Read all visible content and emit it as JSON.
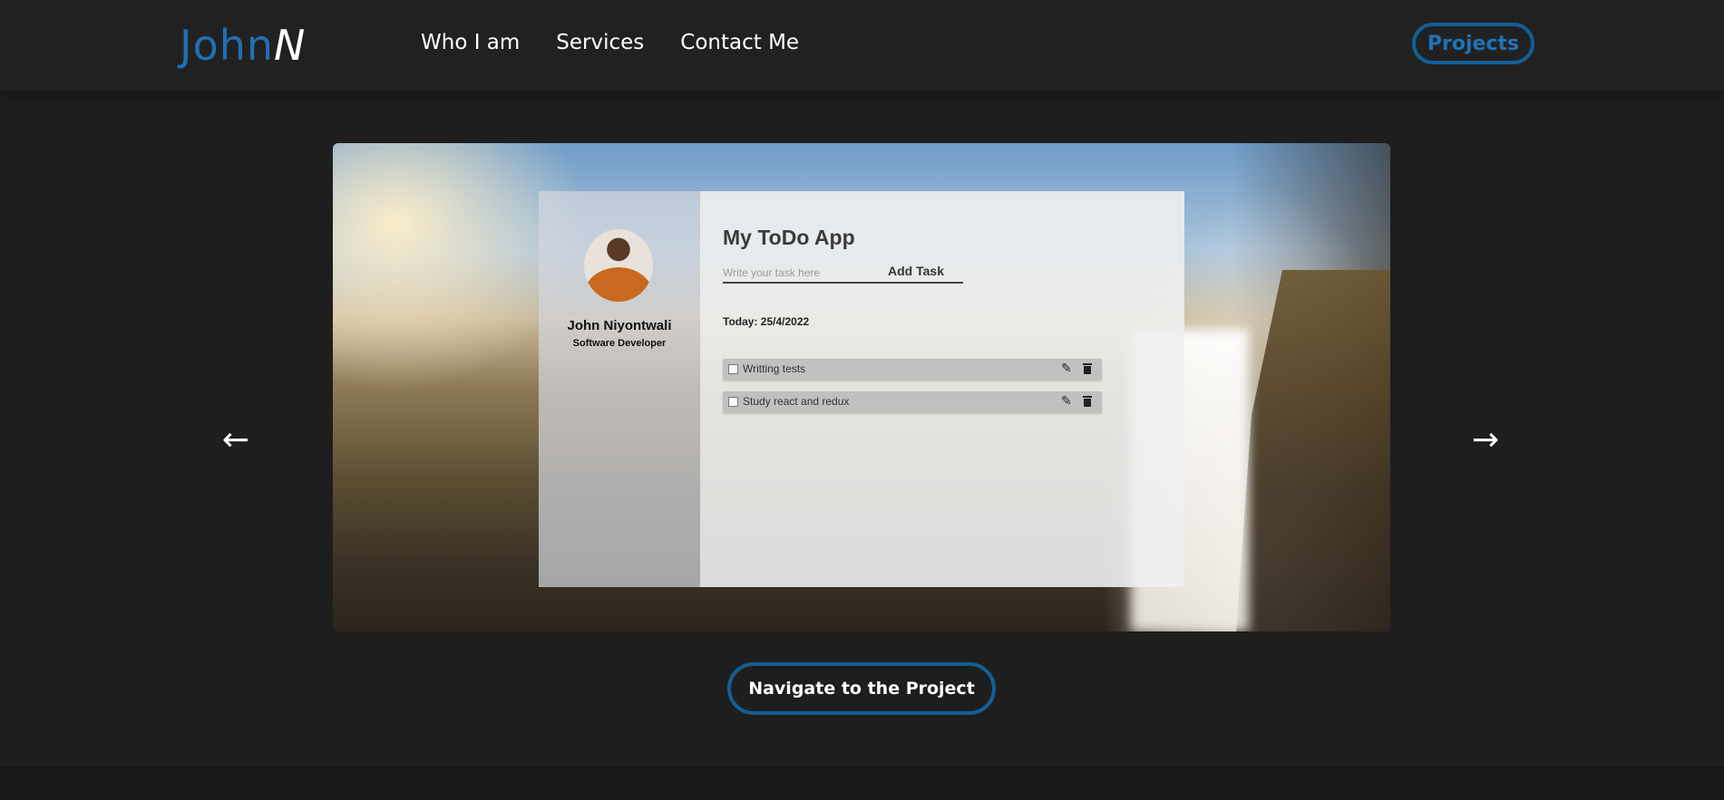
{
  "header": {
    "logo_part1": "John",
    "logo_part2": "N",
    "nav": [
      "Who I am",
      "Services",
      "Contact Me"
    ],
    "projects_label": "Projects"
  },
  "carousel": {
    "prev_arrow": "←",
    "next_arrow": "→"
  },
  "todo": {
    "profile_name": "John Niyontwali",
    "profile_role": "Software Developer",
    "title": "My ToDo App",
    "input_placeholder": "Write your task here",
    "add_label": "Add Task",
    "today": "Today: 25/4/2022",
    "tasks": [
      "Writting tests",
      "Study react and redux"
    ]
  },
  "navigate_label": "Navigate to the Project",
  "colors": {
    "accent": "#135e96",
    "background": "#1e1e1e",
    "header": "#212121"
  }
}
